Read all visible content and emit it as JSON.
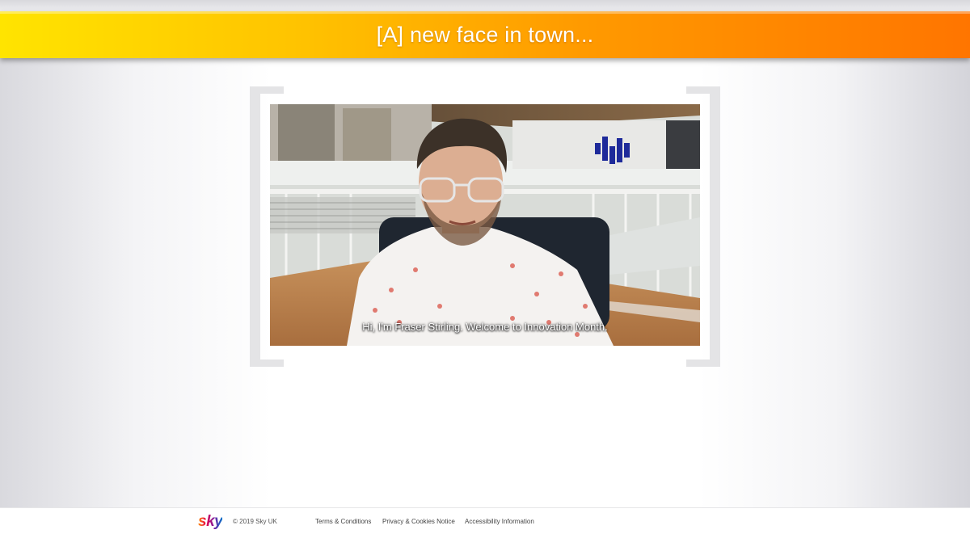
{
  "header": {
    "title": "[A] new face in town..."
  },
  "video": {
    "caption": "Hi, I'm Fraser Stirling. Welcome to Innovation Month."
  },
  "footer": {
    "logo_text": "sky",
    "copyright": "© 2019 Sky UK",
    "links": [
      {
        "label": "Terms & Conditions"
      },
      {
        "label": "Privacy & Cookies Notice"
      },
      {
        "label": "Accessibility Information"
      }
    ]
  },
  "colors": {
    "header_gradient_start": "#ffe400",
    "header_gradient_end": "#ff7500",
    "frame": "#e4e4e6"
  }
}
